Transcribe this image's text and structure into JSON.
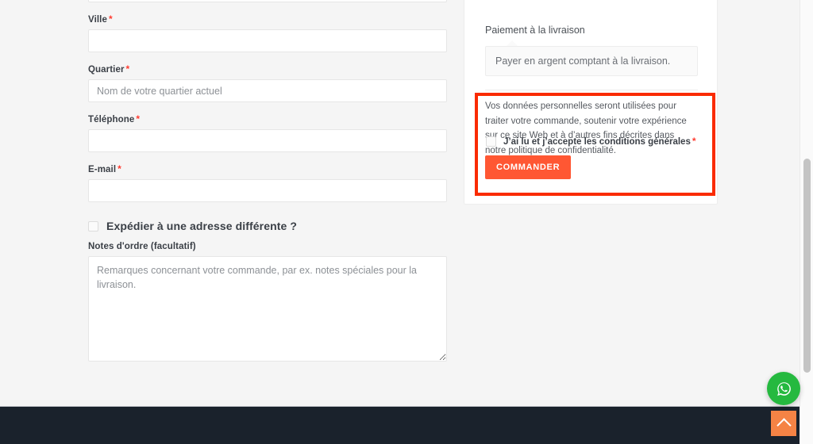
{
  "billing": {
    "fields": [
      {
        "label": "Ville",
        "required": true,
        "value": "",
        "placeholder": ""
      },
      {
        "label": "Quartier",
        "required": true,
        "value": "",
        "placeholder": "Nom de votre quartier actuel"
      },
      {
        "label": "Téléphone",
        "required": true,
        "value": "",
        "placeholder": ""
      },
      {
        "label": "E-mail",
        "required": true,
        "value": "",
        "placeholder": ""
      }
    ],
    "required_marker": "*",
    "ship_to_different_label": "Expédier à une adresse différente ?",
    "notes_label": "Notes d'ordre (facultatif)",
    "notes_placeholder": "Remarques concernant votre commande, par ex. notes spéciales pour la livraison.",
    "notes_value": ""
  },
  "order": {
    "payment_method_label": "Paiement à la livraison",
    "payment_method_description": "Payer en argent comptant à la livraison.",
    "privacy_text": "Vos données personnelles seront utilisées pour traiter votre commande, soutenir votre expérience sur ce site Web et à d’autres fins décrites dans notre politique de confidentialité.",
    "terms_label": "J’ai lu et j’accepte les conditions générales",
    "terms_required_marker": "*",
    "place_order_button": "COMMANDER"
  },
  "floating": {
    "whatsapp_icon": "whatsapp-icon",
    "scroll_top_icon": "chevron-up-icon"
  },
  "colors": {
    "accent_orange": "#ff5733",
    "highlight_red": "#fa2b00",
    "whatsapp_green": "#25b93f",
    "scroll_top_orange": "#f58345",
    "footer_navy": "#1a222c",
    "page_background": "#f5f5f5",
    "required_asterisk": "#ff3b30"
  }
}
